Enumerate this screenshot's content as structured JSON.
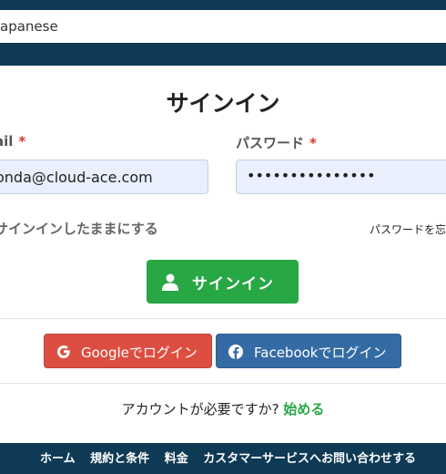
{
  "header": {
    "language_value": "apanese"
  },
  "form": {
    "title": "サインイン",
    "email_label": "ail",
    "email_value": "onda@cloud-ace.com",
    "password_label": "パスワード",
    "password_value": "•••••••••••••••",
    "required_mark": "*",
    "remember_label": "サインインしたままにする",
    "forgot_label": "パスワードを忘",
    "signin_button": "サインイン"
  },
  "social": {
    "google_label": "Googleでログイン",
    "facebook_label": "Facebookでログイン"
  },
  "signup": {
    "prompt": "アカウントが必要ですか? ",
    "link": "始める"
  },
  "footer": {
    "links": [
      "ホーム",
      "規約と条件",
      "料金",
      "カスタマーサービスへお問い合わせする"
    ]
  },
  "colors": {
    "header_bg": "#0f3a55",
    "primary_green": "#28a745",
    "google_red": "#dc4e41",
    "facebook_blue": "#356ba4",
    "required_red": "#d9362c"
  }
}
